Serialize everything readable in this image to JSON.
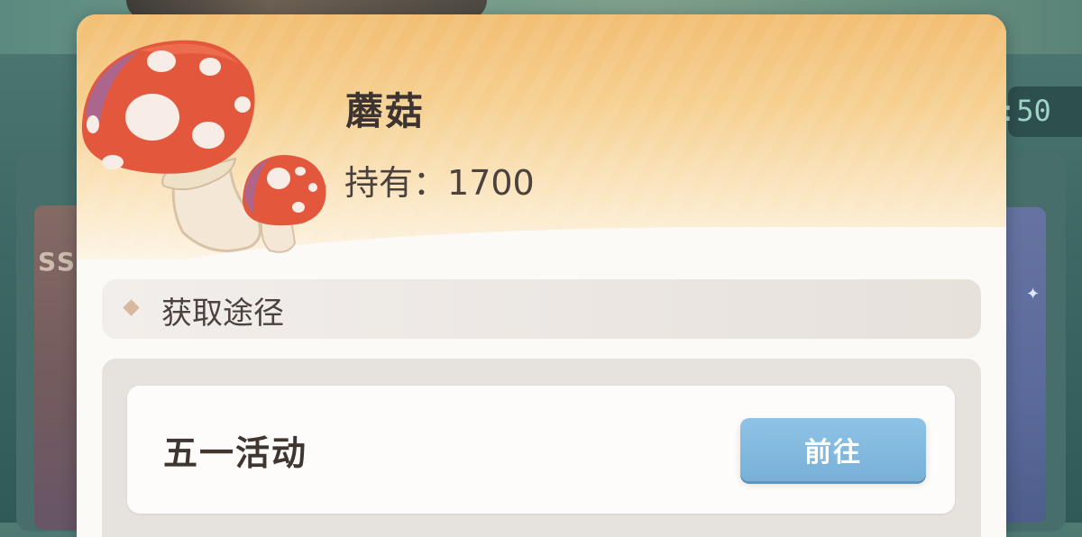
{
  "background": {
    "timer_text": ":50",
    "left_card_text": "SS"
  },
  "item": {
    "name": "蘑菇",
    "owned_label": "持有：",
    "owned_value": "1700",
    "icon": "mushroom-icon"
  },
  "section": {
    "title": "获取途径",
    "icon": "diamond-icon"
  },
  "sources": [
    {
      "label": "五一活动",
      "button_label": "前往"
    }
  ],
  "colors": {
    "header_gold": "#f2be73",
    "button_blue": "#8fc3e6",
    "panel_bg": "#fbfaf7"
  }
}
